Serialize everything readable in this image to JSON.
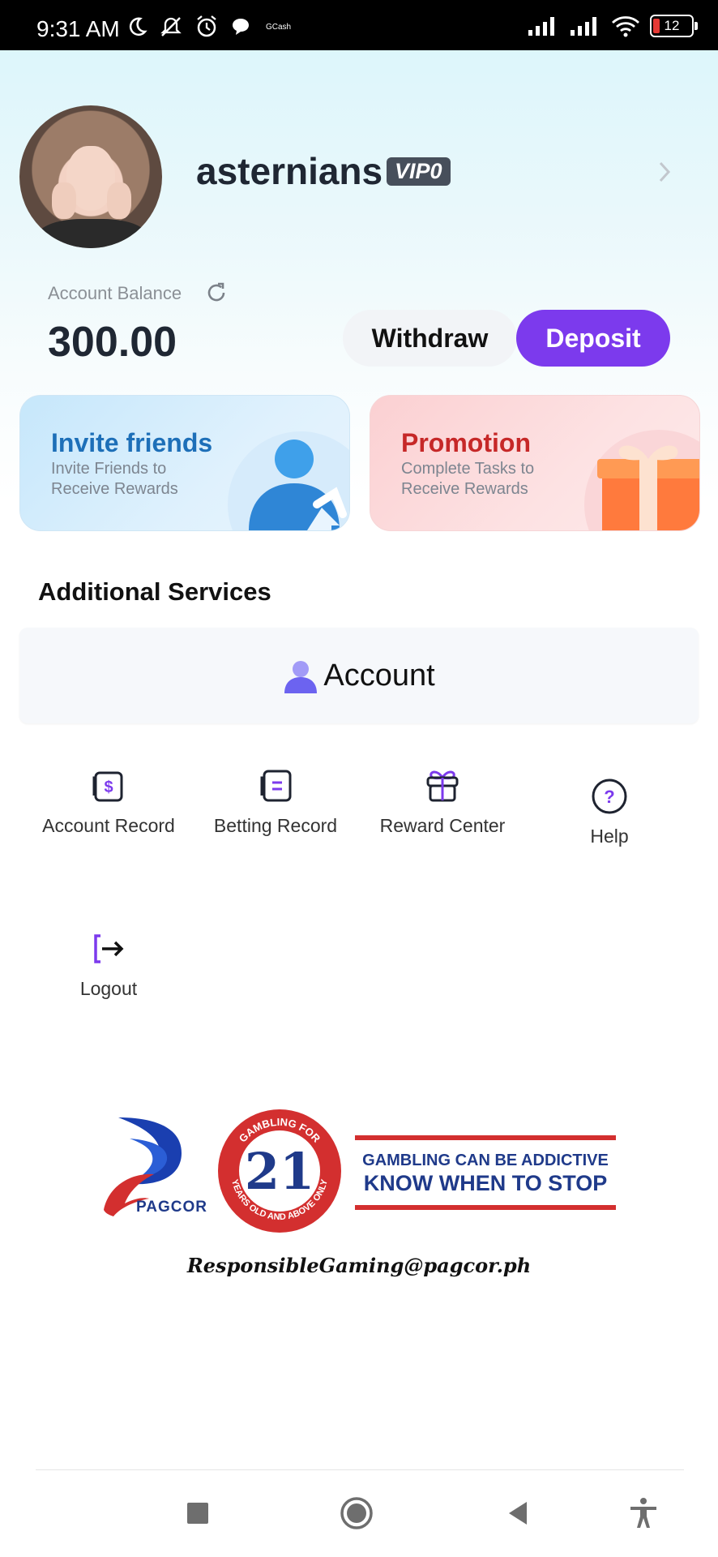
{
  "status_bar": {
    "time": "9:31 AM",
    "gcash": "GCash",
    "battery": "12",
    "icons": [
      "moon-icon",
      "mute-icon",
      "alarm-icon",
      "chat-icon",
      "signal-icon",
      "signal-icon",
      "wifi-icon",
      "battery-icon"
    ]
  },
  "profile": {
    "username": "asternians",
    "vip": "VIP0"
  },
  "balance": {
    "label": "Account Balance",
    "value": "300.00",
    "withdraw_label": "Withdraw",
    "deposit_label": "Deposit"
  },
  "cards": {
    "invite": {
      "title": "Invite friends",
      "subtitle": "Invite Friends to Receive Rewards"
    },
    "promotion": {
      "title": "Promotion",
      "subtitle": "Complete Tasks to Receive Rewards"
    }
  },
  "services": {
    "title": "Additional Services",
    "tab_label": "Account",
    "items": [
      {
        "label": "Account Record",
        "icon": "wallet-dollar-icon"
      },
      {
        "label": "Betting Record",
        "icon": "record-list-icon"
      },
      {
        "label": "Reward Center",
        "icon": "gift-icon"
      },
      {
        "label": "Help",
        "icon": "help-circle-icon"
      },
      {
        "label": "Logout",
        "icon": "logout-icon"
      }
    ]
  },
  "footer": {
    "pagcor": "PAGCOR",
    "seal_top": "GAMBLING FOR",
    "seal_number": "21",
    "seal_bottom": "YEARS OLD AND ABOVE ONLY",
    "warning_line1": "GAMBLING CAN BE ADDICTIVE",
    "warning_line2": "KNOW WHEN TO STOP",
    "email": "ResponsibleGaming@pagcor.ph"
  },
  "colors": {
    "accent": "#7c3aed",
    "invite_title": "#1d6fb8",
    "promo_title": "#c62828",
    "pagcor_blue": "#1f3a8a",
    "pagcor_red": "#d32f2f"
  }
}
